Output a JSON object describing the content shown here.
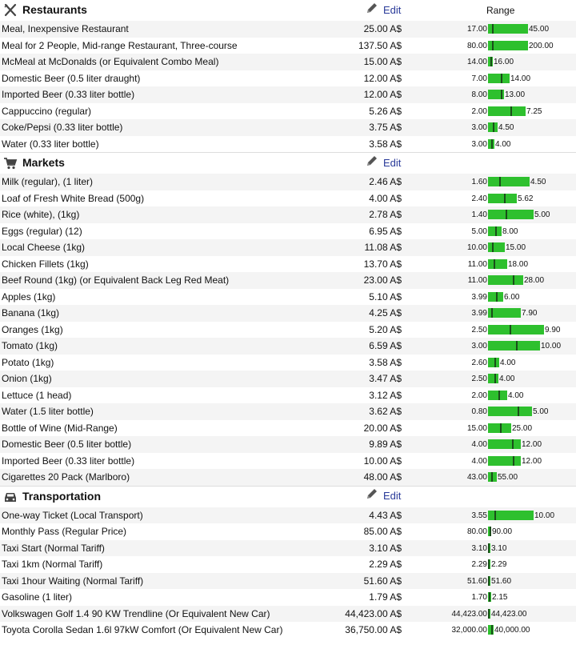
{
  "edit_label": "Edit",
  "range_label": "Range",
  "colors": {
    "bar": "#2ec02e",
    "marker": "#1a4d1a",
    "link": "#2a3a99"
  },
  "sections": [
    {
      "title": "Restaurants",
      "icon": "fork-knife-icon",
      "show_range_label": true,
      "rows": [
        {
          "name": "Meal, Inexpensive Restaurant",
          "price": "25.00 A$",
          "min": "17.00",
          "max": "45.00",
          "bar_fraction": 0.72,
          "marker_fraction": 0.1
        },
        {
          "name": "Meal for 2 People, Mid-range Restaurant, Three-course",
          "price": "137.50 A$",
          "min": "80.00",
          "max": "200.00",
          "bar_fraction": 0.72,
          "marker_fraction": 0.1
        },
        {
          "name": "McMeal at McDonalds (or Equivalent Combo Meal)",
          "price": "15.00 A$",
          "min": "14.00",
          "max": "16.00",
          "bar_fraction": 0.08,
          "marker_fraction": 0.5
        },
        {
          "name": "Domestic Beer (0.5 liter draught)",
          "price": "12.00 A$",
          "min": "7.00",
          "max": "14.00",
          "bar_fraction": 0.38,
          "marker_fraction": 0.6
        },
        {
          "name": "Imported Beer (0.33 liter bottle)",
          "price": "12.00 A$",
          "min": "8.00",
          "max": "13.00",
          "bar_fraction": 0.28,
          "marker_fraction": 0.8
        },
        {
          "name": "Cappuccino (regular)",
          "price": "5.26 A$",
          "min": "2.00",
          "max": "7.25",
          "bar_fraction": 0.67,
          "marker_fraction": 0.6
        },
        {
          "name": "Coke/Pepsi (0.33 liter bottle)",
          "price": "3.75 A$",
          "min": "3.00",
          "max": "4.50",
          "bar_fraction": 0.17,
          "marker_fraction": 0.5
        },
        {
          "name": "Water (0.33 liter bottle)",
          "price": "3.58 A$",
          "min": "3.00",
          "max": "4.00",
          "bar_fraction": 0.11,
          "marker_fraction": 0.5
        }
      ]
    },
    {
      "title": "Markets",
      "icon": "shopping-cart-icon",
      "show_range_label": false,
      "rows": [
        {
          "name": "Milk (regular), (1 liter)",
          "price": "2.46 A$",
          "min": "1.60",
          "max": "4.50",
          "bar_fraction": 0.74,
          "marker_fraction": 0.27
        },
        {
          "name": "Loaf of Fresh White Bread (500g)",
          "price": "4.00 A$",
          "min": "2.40",
          "max": "5.62",
          "bar_fraction": 0.52,
          "marker_fraction": 0.55
        },
        {
          "name": "Rice (white), (1kg)",
          "price": "2.78 A$",
          "min": "1.40",
          "max": "5.00",
          "bar_fraction": 0.82,
          "marker_fraction": 0.38
        },
        {
          "name": "Eggs (regular) (12)",
          "price": "6.95 A$",
          "min": "5.00",
          "max": "8.00",
          "bar_fraction": 0.24,
          "marker_fraction": 0.55
        },
        {
          "name": "Local Cheese (1kg)",
          "price": "11.08 A$",
          "min": "10.00",
          "max": "15.00",
          "bar_fraction": 0.3,
          "marker_fraction": 0.25
        },
        {
          "name": "Chicken Fillets (1kg)",
          "price": "13.70 A$",
          "min": "11.00",
          "max": "18.00",
          "bar_fraction": 0.34,
          "marker_fraction": 0.3
        },
        {
          "name": "Beef Round (1kg) (or Equivalent Back Leg Red Meat)",
          "price": "23.00 A$",
          "min": "11.00",
          "max": "28.00",
          "bar_fraction": 0.63,
          "marker_fraction": 0.7
        },
        {
          "name": "Apples (1kg)",
          "price": "5.10 A$",
          "min": "3.99",
          "max": "6.00",
          "bar_fraction": 0.27,
          "marker_fraction": 0.5
        },
        {
          "name": "Banana (1kg)",
          "price": "4.25 A$",
          "min": "3.99",
          "max": "7.90",
          "bar_fraction": 0.58,
          "marker_fraction": 0.1
        },
        {
          "name": "Oranges (1kg)",
          "price": "5.20 A$",
          "min": "2.50",
          "max": "9.90",
          "bar_fraction": 1.0,
          "marker_fraction": 0.38
        },
        {
          "name": "Tomato (1kg)",
          "price": "6.59 A$",
          "min": "3.00",
          "max": "10.00",
          "bar_fraction": 0.93,
          "marker_fraction": 0.54
        },
        {
          "name": "Potato (1kg)",
          "price": "3.58 A$",
          "min": "2.60",
          "max": "4.00",
          "bar_fraction": 0.2,
          "marker_fraction": 0.6
        },
        {
          "name": "Onion (1kg)",
          "price": "3.47 A$",
          "min": "2.50",
          "max": "4.00",
          "bar_fraction": 0.18,
          "marker_fraction": 0.6
        },
        {
          "name": "Lettuce (1 head)",
          "price": "3.12 A$",
          "min": "2.00",
          "max": "4.00",
          "bar_fraction": 0.34,
          "marker_fraction": 0.55
        },
        {
          "name": "Water (1.5 liter bottle)",
          "price": "3.62 A$",
          "min": "0.80",
          "max": "5.00",
          "bar_fraction": 0.78,
          "marker_fraction": 0.67
        },
        {
          "name": "Bottle of Wine (Mid-Range)",
          "price": "20.00 A$",
          "min": "15.00",
          "max": "25.00",
          "bar_fraction": 0.42,
          "marker_fraction": 0.5
        },
        {
          "name": "Domestic Beer (0.5 liter bottle)",
          "price": "9.89 A$",
          "min": "4.00",
          "max": "12.00",
          "bar_fraction": 0.58,
          "marker_fraction": 0.74
        },
        {
          "name": "Imported Beer (0.33 liter bottle)",
          "price": "10.00 A$",
          "min": "4.00",
          "max": "12.00",
          "bar_fraction": 0.58,
          "marker_fraction": 0.75
        },
        {
          "name": "Cigarettes 20 Pack (Marlboro)",
          "price": "48.00 A$",
          "min": "43.00",
          "max": "55.00",
          "bar_fraction": 0.15,
          "marker_fraction": 0.4
        }
      ]
    },
    {
      "title": "Transportation",
      "icon": "car-icon",
      "show_range_label": false,
      "rows": [
        {
          "name": "One-way Ticket (Local Transport)",
          "price": "4.43 A$",
          "min": "3.55",
          "max": "10.00",
          "bar_fraction": 0.82,
          "marker_fraction": 0.14
        },
        {
          "name": "Monthly Pass (Regular Price)",
          "price": "85.00 A$",
          "min": "80.00",
          "max": "90.00",
          "bar_fraction": 0.05,
          "marker_fraction": 0.5
        },
        {
          "name": "Taxi Start (Normal Tariff)",
          "price": "3.10 A$",
          "min": "3.10",
          "max": "3.10",
          "bar_fraction": 0.03,
          "marker_fraction": 0.0
        },
        {
          "name": "Taxi 1km (Normal Tariff)",
          "price": "2.29 A$",
          "min": "2.29",
          "max": "2.29",
          "bar_fraction": 0.03,
          "marker_fraction": 0.0
        },
        {
          "name": "Taxi 1hour Waiting (Normal Tariff)",
          "price": "51.60 A$",
          "min": "51.60",
          "max": "51.60",
          "bar_fraction": 0.03,
          "marker_fraction": 0.0
        },
        {
          "name": "Gasoline (1 liter)",
          "price": "1.79 A$",
          "min": "1.70",
          "max": "2.15",
          "bar_fraction": 0.06,
          "marker_fraction": 0.25
        },
        {
          "name": "Volkswagen Golf 1.4 90 KW Trendline (Or Equivalent New Car)",
          "price": "44,423.00 A$",
          "min": "44,423.00",
          "max": "44,423.00",
          "bar_fraction": 0.03,
          "marker_fraction": 0.0
        },
        {
          "name": "Toyota Corolla Sedan 1.6l 97kW Comfort (Or Equivalent New Car)",
          "price": "36,750.00 A$",
          "min": "32,000.00",
          "max": "40,000.00",
          "bar_fraction": 0.1,
          "marker_fraction": 0.6
        }
      ]
    }
  ]
}
